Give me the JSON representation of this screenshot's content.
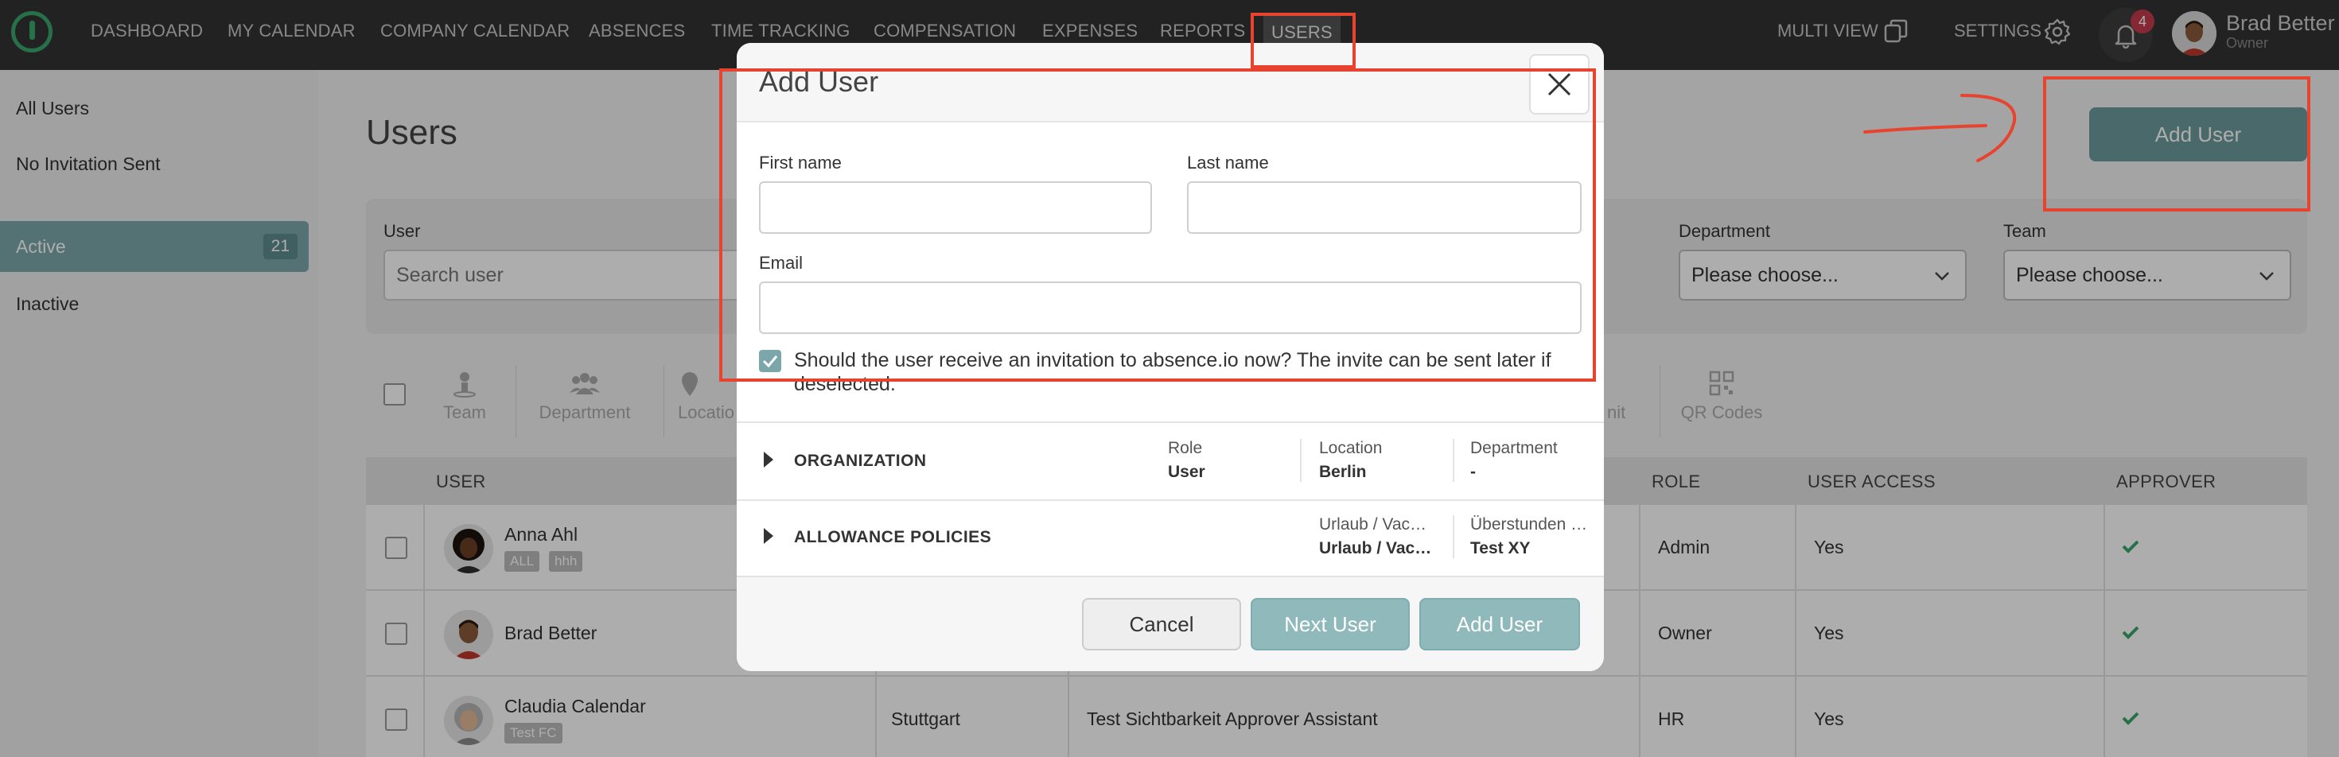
{
  "nav": {
    "items": [
      "DASHBOARD",
      "MY CALENDAR",
      "COMPANY CALENDAR",
      "ABSENCES",
      "TIME TRACKING",
      "COMPENSATION",
      "EXPENSES",
      "REPORTS",
      "USERS"
    ],
    "active": "USERS",
    "multi_view": "MULTI VIEW",
    "settings": "SETTINGS",
    "notifications": "4",
    "user_name": "Brad Better",
    "user_role": "Owner"
  },
  "sidebar": {
    "items": [
      {
        "label": "All Users"
      },
      {
        "label": "No Invitation Sent"
      },
      {
        "label": "Active",
        "count": "21"
      },
      {
        "label": "Inactive"
      }
    ]
  },
  "page": {
    "title": "Users",
    "add_user_button": "Add User"
  },
  "filters": {
    "user_label": "User",
    "user_placeholder": "Search user",
    "department_label": "Department",
    "department_value": "Please choose...",
    "team_label": "Team",
    "team_value": "Please choose..."
  },
  "toolbar": {
    "team": "Team",
    "department": "Department",
    "location": "Locatio",
    "unit": "nit",
    "qr_codes": "QR Codes"
  },
  "table": {
    "headers": {
      "user": "USER",
      "role": "ROLE",
      "user_access": "USER ACCESS",
      "approver": "APPROVER"
    },
    "rows": [
      {
        "name": "Anna Ahl",
        "tags": [
          "ALL",
          "hhh"
        ],
        "location": "",
        "approver_text": "",
        "role": "Admin",
        "access": "Yes",
        "approver": true
      },
      {
        "name": "Brad Better",
        "tags": [],
        "location": "",
        "approver_text": "",
        "role": "Owner",
        "access": "Yes",
        "approver": true
      },
      {
        "name": "Claudia Calendar",
        "tags": [
          "Test FC"
        ],
        "location": "Stuttgart",
        "approver_text": "Test Sichtbarkeit Approver Assistant",
        "role": "HR",
        "access": "Yes",
        "approver": true
      }
    ]
  },
  "modal": {
    "title": "Add User",
    "first_name_label": "First name",
    "last_name_label": "Last name",
    "email_label": "Email",
    "first_name_value": "",
    "last_name_value": "",
    "email_value": "",
    "invite_checked": true,
    "invite_text": "Should the user receive an invitation to absence.io now? The invite can be sent later if deselected.",
    "organization": {
      "title": "ORGANIZATION",
      "role_label": "Role",
      "role_value": "User",
      "location_label": "Location",
      "location_value": "Berlin",
      "department_label": "Department",
      "department_value": "-"
    },
    "allowance": {
      "title": "ALLOWANCE POLICIES",
      "col1_label": "Urlaub / Vac…",
      "col1_value": "Urlaub / Vac…",
      "col2_label": "Überstunden …",
      "col2_value": "Test XY"
    },
    "buttons": {
      "cancel": "Cancel",
      "next": "Next User",
      "add": "Add User"
    }
  },
  "colors": {
    "accent": "#7ca7aa",
    "annotation": "#e8432e",
    "topbar": "#333333",
    "check_green": "#3aa76d"
  }
}
